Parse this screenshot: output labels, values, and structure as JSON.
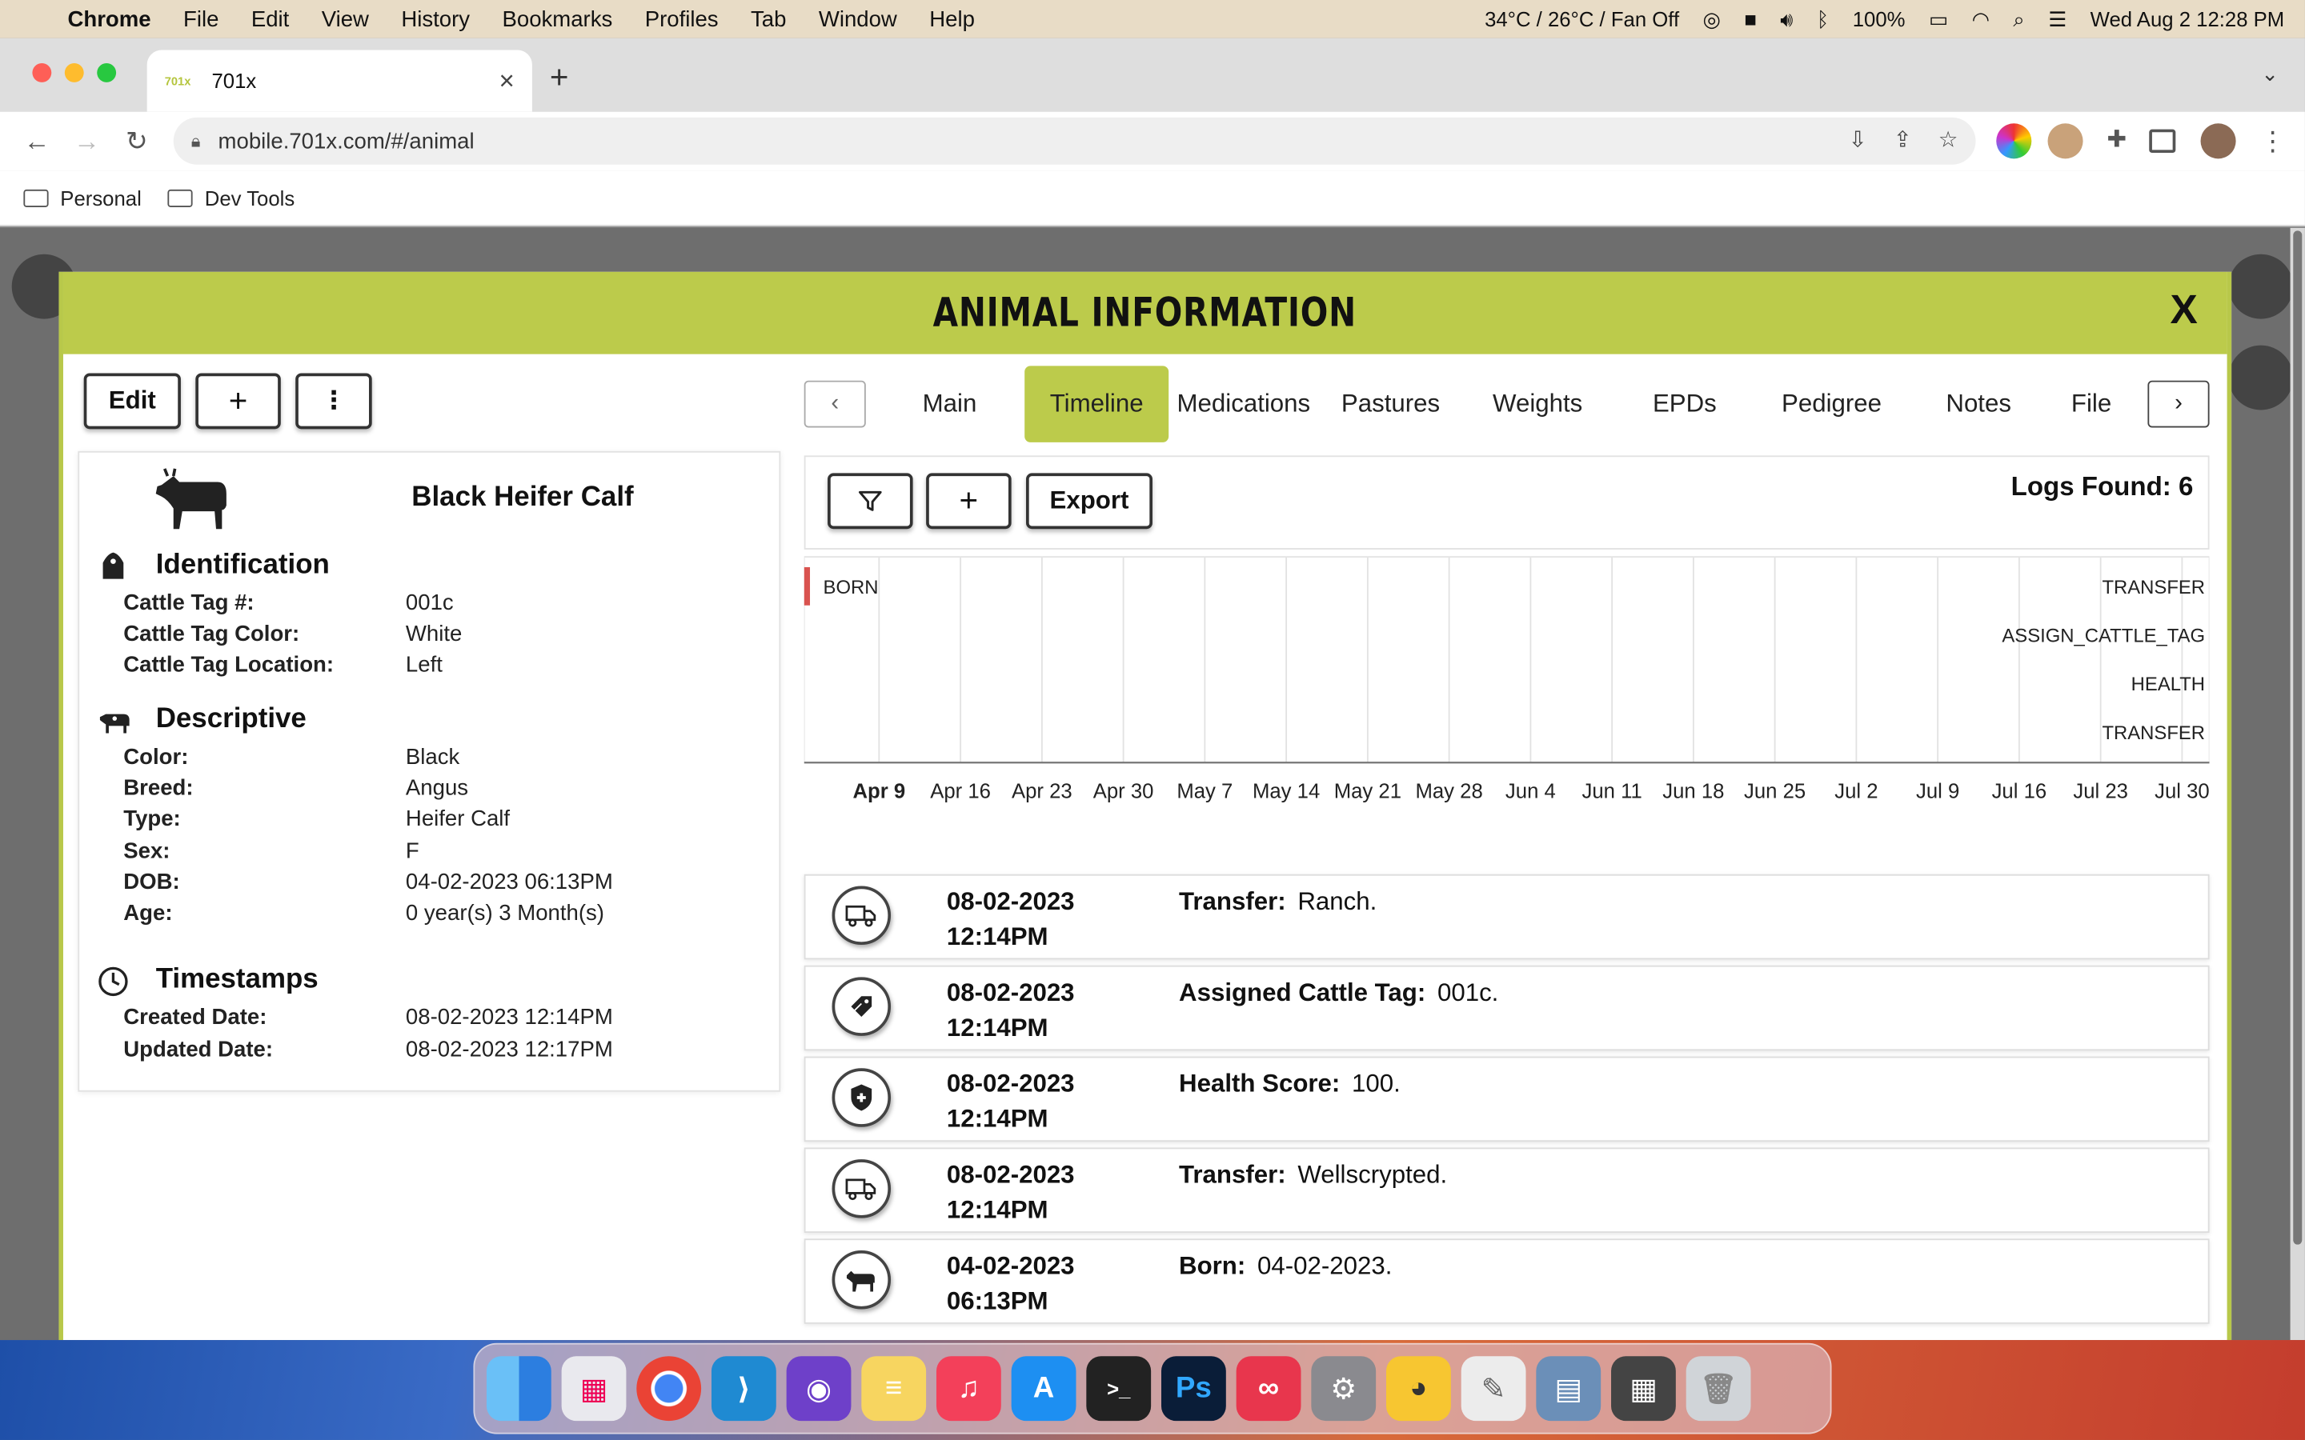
{
  "menubar": {
    "app": "Chrome",
    "items": [
      "File",
      "Edit",
      "View",
      "History",
      "Bookmarks",
      "Profiles",
      "Tab",
      "Window",
      "Help"
    ],
    "weather": "34°C / 26°C / Fan Off",
    "battery": "100%",
    "clock": "Wed Aug 2  12:28 PM"
  },
  "browser": {
    "tab_title": "701x",
    "tab_favicon": "701x",
    "url": "mobile.701x.com/#/animal",
    "bookmarks": [
      "Personal",
      "Dev Tools"
    ]
  },
  "modal": {
    "title": "ANIMAL INFORMATION",
    "close": "X",
    "edit_label": "Edit",
    "add_label": "+",
    "more_label": "⋮",
    "animal_name": "Black Heifer Calf",
    "sections": {
      "identification": {
        "title": "Identification",
        "rows": [
          {
            "k": "Cattle Tag #:",
            "v": "001c"
          },
          {
            "k": "Cattle Tag Color:",
            "v": "White"
          },
          {
            "k": "Cattle Tag Location:",
            "v": "Left"
          }
        ]
      },
      "descriptive": {
        "title": "Descriptive",
        "rows": [
          {
            "k": "Color:",
            "v": "Black"
          },
          {
            "k": "Breed:",
            "v": "Angus"
          },
          {
            "k": "Type:",
            "v": "Heifer Calf"
          },
          {
            "k": "Sex:",
            "v": "F"
          },
          {
            "k": "DOB:",
            "v": "04-02-2023 06:13PM"
          },
          {
            "k": "Age:",
            "v": "0 year(s) 3 Month(s)"
          }
        ]
      },
      "timestamps": {
        "title": "Timestamps",
        "rows": [
          {
            "k": "Created Date:",
            "v": "08-02-2023 12:14PM"
          },
          {
            "k": "Updated Date:",
            "v": "08-02-2023 12:17PM"
          }
        ]
      }
    },
    "tabs": [
      "Main",
      "Timeline",
      "Medications",
      "Pastures",
      "Weights",
      "EPDs",
      "Pedigree",
      "Notes",
      "File"
    ],
    "active_tab": "Timeline",
    "export_label": "Export",
    "logs_found": "Logs Found: 6",
    "timeline": {
      "ticks": [
        "Apr 9",
        "Apr 16",
        "Apr 23",
        "Apr 30",
        "May 7",
        "May 14",
        "May 21",
        "May 28",
        "Jun 4",
        "Jun 11",
        "Jun 18",
        "Jun 25",
        "Jul 2",
        "Jul 9",
        "Jul 16",
        "Jul 23",
        "Jul 30"
      ],
      "left_events": [
        "BORN"
      ],
      "right_events": [
        "TRANSFER",
        "ASSIGN_CATTLE_TAG",
        "HEALTH",
        "TRANSFER"
      ]
    },
    "entries": [
      {
        "icon": "truck-icon",
        "date": "08-02-2023",
        "time": "12:14PM",
        "label": "Transfer:",
        "value": "Ranch."
      },
      {
        "icon": "tag-icon",
        "date": "08-02-2023",
        "time": "12:14PM",
        "label": "Assigned Cattle Tag:",
        "value": "001c."
      },
      {
        "icon": "shield-icon",
        "date": "08-02-2023",
        "time": "12:14PM",
        "label": "Health Score:",
        "value": "100."
      },
      {
        "icon": "truck-icon",
        "date": "08-02-2023",
        "time": "12:14PM",
        "label": "Transfer:",
        "value": "Wellscrypted."
      },
      {
        "icon": "cow-icon",
        "date": "04-02-2023",
        "time": "06:13PM",
        "label": "Born:",
        "value": "04-02-2023."
      }
    ]
  },
  "colors": {
    "accent": "#bccb4b",
    "born_marker": "#d9534f"
  }
}
